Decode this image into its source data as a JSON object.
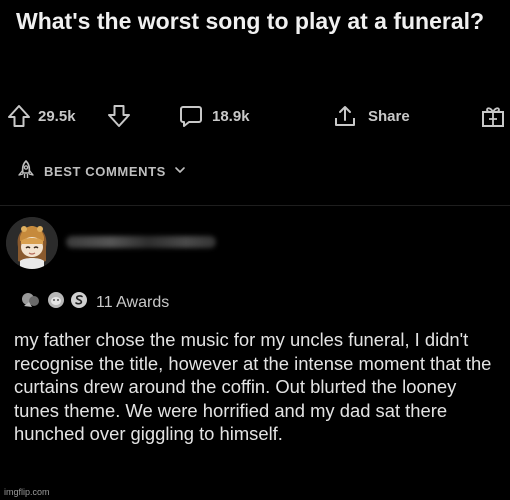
{
  "post": {
    "title": "What's the worst song to play at a funeral?"
  },
  "actions": {
    "upvotes": "29.5k",
    "comments": "18.9k",
    "share_label": "Share"
  },
  "comments_section": {
    "sort_label": "BEST COMMENTS"
  },
  "comment": {
    "awards_label": "11 Awards",
    "body": "my father chose the music for my uncles funeral, I didn't recognise the title, however at the intense moment that the curtains drew around the coffin. Out blurted the looney tunes theme. We were horrified and my dad sat there hunched over giggling to himself."
  },
  "watermark": "imgflip.com",
  "colors": {
    "background": "#000000",
    "text": "#e3e3e3",
    "muted": "#c8c8c8"
  },
  "icons": [
    "upvote-icon",
    "downvote-icon",
    "comment-icon",
    "share-icon",
    "gift-icon",
    "rocket-icon",
    "chevron-down-icon",
    "award-icon"
  ]
}
